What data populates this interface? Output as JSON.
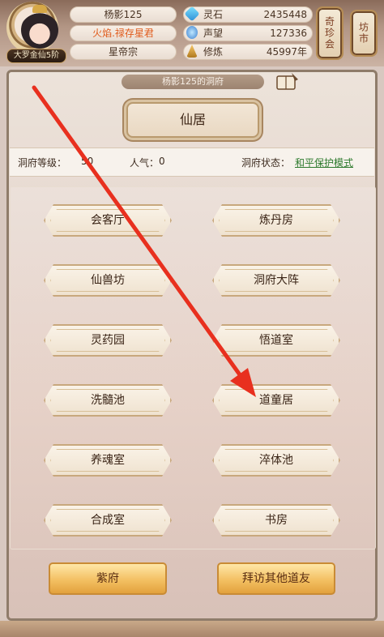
{
  "header": {
    "player_name": "杨影125",
    "title": "火焰.禄存星君",
    "sect": "星帝宗",
    "rank": "大罗金仙5阶",
    "resources": [
      {
        "icon": "spirit-stone-icon",
        "label": "灵石",
        "value": "2435448"
      },
      {
        "icon": "prestige-icon",
        "label": "声望",
        "value": "127336"
      },
      {
        "icon": "cultivation-icon",
        "label": "修炼",
        "value": "45997年"
      }
    ],
    "side_buttons": [
      "奇珍会",
      "坊市"
    ]
  },
  "cave": {
    "heading": "杨影125的洞府",
    "main_room": "仙居",
    "level_label": "洞府等级：",
    "level_value": "50",
    "popularity_label": "人气：",
    "popularity_value": "0",
    "state_label": "洞府状态：",
    "state_value": "和平保护模式",
    "rooms": [
      "会客厅",
      "炼丹房",
      "仙兽坊",
      "洞府大阵",
      "灵药园",
      "悟道室",
      "洗髓池",
      "道童居",
      "养魂室",
      "淬体池",
      "合成室",
      "书房"
    ],
    "bottom_buttons": [
      "紫府",
      "拜访其他道友"
    ]
  },
  "colors": {
    "accent_link": "#2d7a2d",
    "title_orange": "#e05a1b",
    "arrow_red": "#e8301f"
  }
}
